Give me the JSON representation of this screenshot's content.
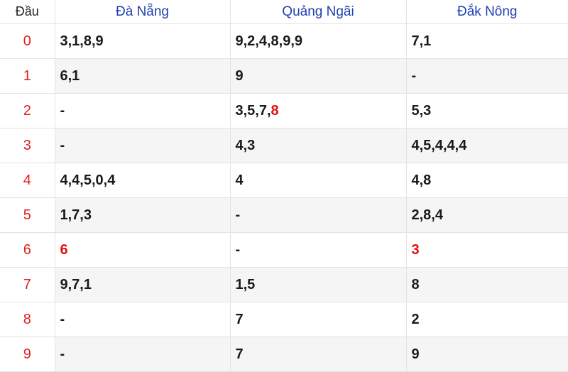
{
  "header": {
    "dau": "Đầu",
    "provinces": [
      "Đà Nẵng",
      "Quảng Ngãi",
      "Đắk Nông"
    ]
  },
  "colors": {
    "header_text": "#1f3fb0",
    "head_digit": "#e02020",
    "highlight": "#e01010"
  },
  "rows": [
    {
      "dau": "0",
      "cells": [
        {
          "text": "3,1,8,9"
        },
        {
          "text": "9,2,4,8,9,9"
        },
        {
          "text": "7,1"
        }
      ]
    },
    {
      "dau": "1",
      "cells": [
        {
          "text": "6,1"
        },
        {
          "text": "9"
        },
        {
          "text": "-"
        }
      ]
    },
    {
      "dau": "2",
      "cells": [
        {
          "text": "-"
        },
        {
          "text": "3,5,7,",
          "highlight": "8"
        },
        {
          "text": "5,3"
        }
      ]
    },
    {
      "dau": "3",
      "cells": [
        {
          "text": "-"
        },
        {
          "text": "4,3"
        },
        {
          "text": "4,5,4,4,4"
        }
      ]
    },
    {
      "dau": "4",
      "cells": [
        {
          "text": "4,4,5,0,4"
        },
        {
          "text": "4"
        },
        {
          "text": "4,8"
        }
      ]
    },
    {
      "dau": "5",
      "cells": [
        {
          "text": "1,7,3"
        },
        {
          "text": "-"
        },
        {
          "text": "2,8,4"
        }
      ]
    },
    {
      "dau": "6",
      "cells": [
        {
          "text": "",
          "highlight": "6"
        },
        {
          "text": "-"
        },
        {
          "text": "",
          "highlight": "3"
        }
      ]
    },
    {
      "dau": "7",
      "cells": [
        {
          "text": "9,7,1"
        },
        {
          "text": "1,5"
        },
        {
          "text": "8"
        }
      ]
    },
    {
      "dau": "8",
      "cells": [
        {
          "text": "-"
        },
        {
          "text": "7"
        },
        {
          "text": "2"
        }
      ]
    },
    {
      "dau": "9",
      "cells": [
        {
          "text": "-"
        },
        {
          "text": "7"
        },
        {
          "text": "9"
        }
      ]
    }
  ]
}
